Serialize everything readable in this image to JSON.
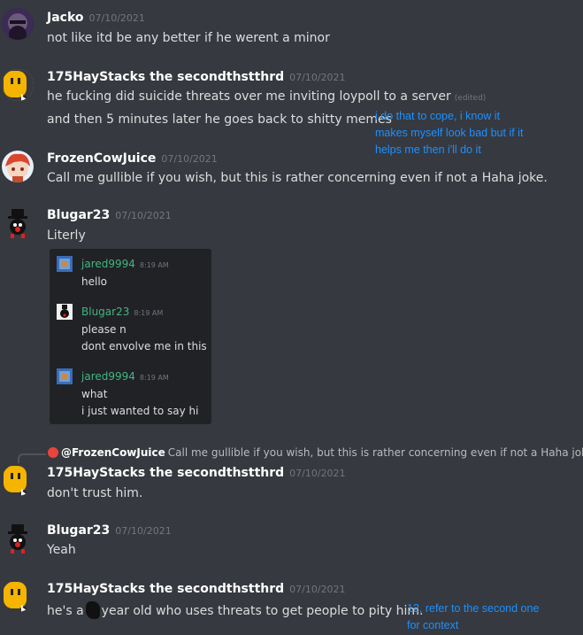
{
  "messages": [
    {
      "username": "Jacko",
      "timestamp": "07/10/2021",
      "lines": [
        "not like itd be any better if he werent a minor"
      ]
    },
    {
      "username": "175HayStacks the secondthstthrd",
      "timestamp": "07/10/2021",
      "lines": [
        "he fucking did suicide threats over me inviting loypoll to a server",
        "and then 5 minutes later he goes back to shitty memes"
      ],
      "edited_label": "(edited)"
    },
    {
      "username": "FrozenCowJuice",
      "timestamp": "07/10/2021",
      "lines": [
        "Call me gullible if you wish, but this is rather concerning even if not a Haha joke."
      ]
    },
    {
      "username": "Blugar23",
      "timestamp": "07/10/2021",
      "lines": [
        "Literly"
      ]
    },
    {
      "username": "175HayStacks the secondthstthrd",
      "timestamp": "07/10/2021",
      "lines": [
        "don't trust him."
      ],
      "reply": {
        "mention": "@FrozenCowJuice",
        "text": "Call me gullible if you wish, but this is rather concerning even if not a Haha joke."
      }
    },
    {
      "username": "Blugar23",
      "timestamp": "07/10/2021",
      "lines": [
        "Yeah"
      ]
    },
    {
      "username": "175HayStacks the secondthstthrd",
      "timestamp": "07/10/2021",
      "line_before": "he's a",
      "line_after": "year old who uses threats to get people to pity him."
    }
  ],
  "embed": [
    {
      "username": "jared9994",
      "name_color": "#43b581",
      "timestamp": "8:19 AM",
      "lines": [
        "hello"
      ]
    },
    {
      "username": "Blugar23",
      "name_color": "#43b581",
      "timestamp": "8:19 AM",
      "lines": [
        "please n",
        "dont envolve me in this"
      ]
    },
    {
      "username": "jared9994",
      "name_color": "#43b581",
      "timestamp": "8:19 AM",
      "lines": [
        "what",
        "i just wanted to say hi"
      ]
    }
  ],
  "annotations": {
    "note_1": [
      "i do that to cope, i know it",
      "makes myself look bad but if it",
      "helps me then i'll do it"
    ],
    "note_2": [
      "12, refer to the second one",
      "for context"
    ]
  },
  "colors": {
    "background": "#36393f",
    "annotation": "#1e90ff",
    "embed_name": "#43b581"
  }
}
